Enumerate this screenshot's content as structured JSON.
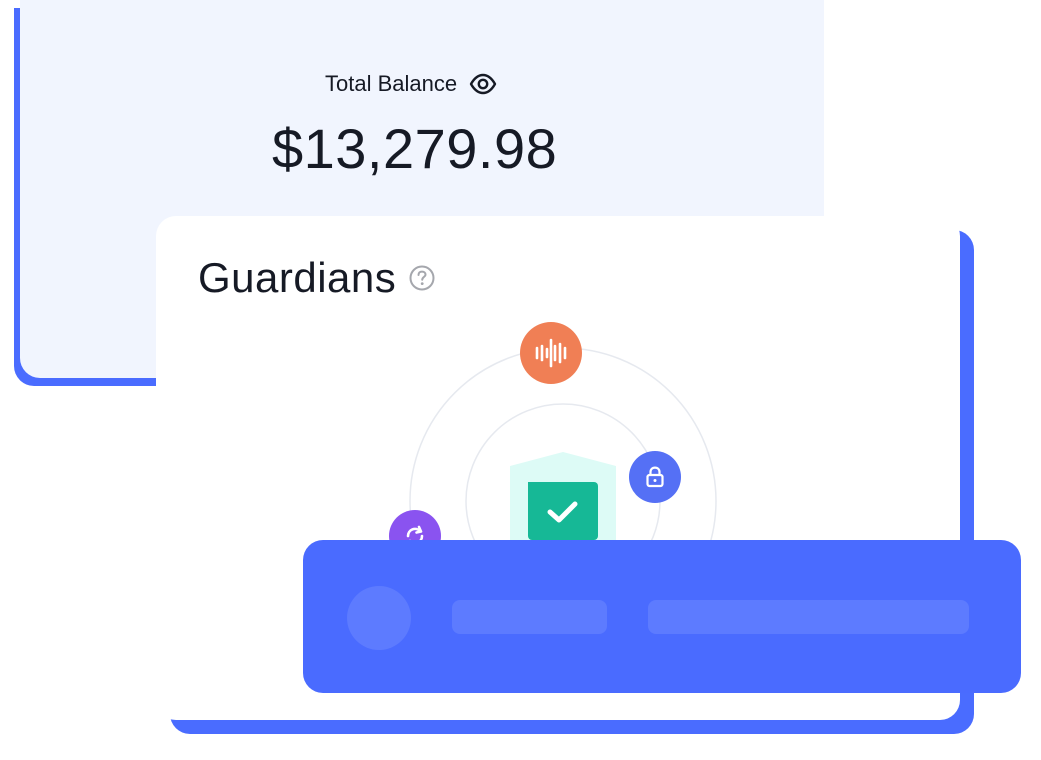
{
  "balance": {
    "label": "Total Balance",
    "amount": "$13,279.98",
    "icon": "eye-icon"
  },
  "guardians": {
    "title": "Guardians",
    "help_icon": "question-circle-icon",
    "nodes": [
      {
        "name": "audio-wave",
        "icon": "waveform-icon",
        "color": "#f07f55"
      },
      {
        "name": "lock",
        "icon": "lock-icon",
        "color": "#5570f5"
      },
      {
        "name": "recovery",
        "icon": "refresh-icon",
        "color": "#8a53f0"
      },
      {
        "name": "shield",
        "icon": "shield-check-icon",
        "color": "#1cb89a"
      }
    ]
  },
  "colors": {
    "accent": "#4a6bff",
    "card_bg": "#f1f5fe",
    "text": "#161a25"
  }
}
